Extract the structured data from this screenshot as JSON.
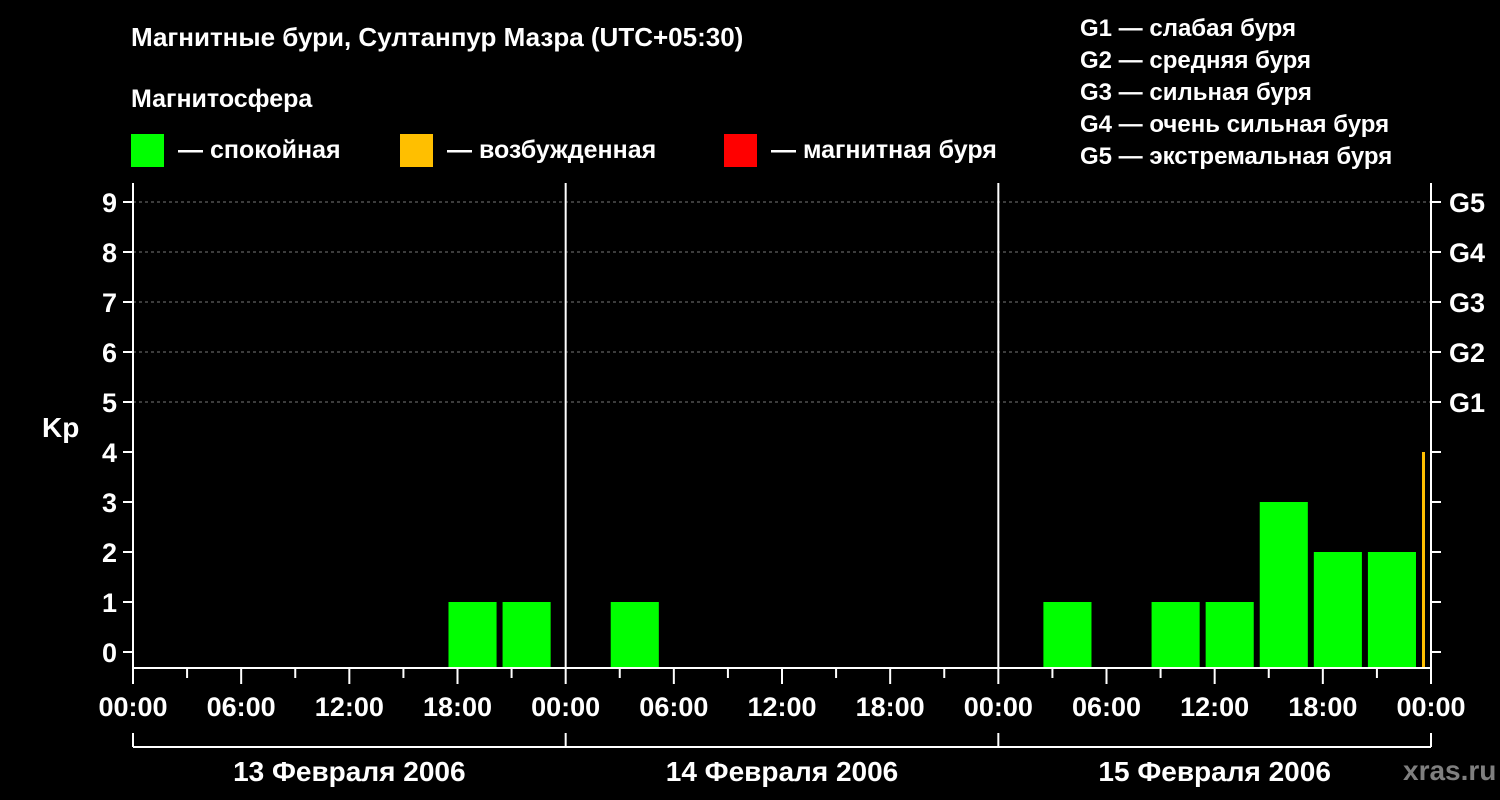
{
  "chart_data": {
    "type": "bar",
    "title": "Магнитные бури, Султанпур Мазра (UTC+05:30)",
    "subtitle": "Магнитосфера",
    "ylabel": "Kp",
    "ylim": [
      0,
      9
    ],
    "y_ticks": [
      "0",
      "1",
      "2",
      "3",
      "4",
      "5",
      "6",
      "7",
      "8",
      "9"
    ],
    "g_ticks": [
      {
        "kp": 5,
        "label": "G1"
      },
      {
        "kp": 6,
        "label": "G2"
      },
      {
        "kp": 7,
        "label": "G3"
      },
      {
        "kp": 8,
        "label": "G4"
      },
      {
        "kp": 9,
        "label": "G5"
      }
    ],
    "x_tick_labels": [
      "00:00",
      "06:00",
      "12:00",
      "18:00",
      "00:00",
      "06:00",
      "12:00",
      "18:00",
      "00:00",
      "06:00",
      "12:00",
      "18:00",
      "00:00"
    ],
    "days": [
      "13 Февраля 2006",
      "14 Февраля 2006",
      "15 Февраля 2006"
    ],
    "legend": [
      {
        "label": "— спокойная",
        "color": "#00ff00"
      },
      {
        "label": "— возбужденная",
        "color": "#ffbf00"
      },
      {
        "label": "— магнитная буря",
        "color": "#ff0000"
      }
    ],
    "g_scale": [
      "G1 — слабая буря",
      "G2 — средняя буря",
      "G3 — сильная буря",
      "G4 — очень сильная буря",
      "G5 — экстремальная буря"
    ],
    "bars": [
      {
        "day": 0,
        "start_hour": 17.5,
        "end_hour": 20.5,
        "kp": 1,
        "state": "quiet"
      },
      {
        "day": 0,
        "start_hour": 20.5,
        "end_hour": 23.5,
        "kp": 1,
        "state": "quiet"
      },
      {
        "day": 1,
        "start_hour": 2.5,
        "end_hour": 5.5,
        "kp": 1,
        "state": "quiet"
      },
      {
        "day": 2,
        "start_hour": 2.5,
        "end_hour": 5.5,
        "kp": 1,
        "state": "quiet"
      },
      {
        "day": 2,
        "start_hour": 8.5,
        "end_hour": 11.5,
        "kp": 1,
        "state": "quiet"
      },
      {
        "day": 2,
        "start_hour": 11.5,
        "end_hour": 14.5,
        "kp": 1,
        "state": "quiet"
      },
      {
        "day": 2,
        "start_hour": 14.5,
        "end_hour": 17.5,
        "kp": 3,
        "state": "quiet"
      },
      {
        "day": 2,
        "start_hour": 17.5,
        "end_hour": 20.5,
        "kp": 2,
        "state": "quiet"
      },
      {
        "day": 2,
        "start_hour": 20.5,
        "end_hour": 23.5,
        "kp": 2,
        "state": "quiet"
      },
      {
        "day": 2,
        "start_hour": 23.5,
        "end_hour": 24,
        "kp": 4,
        "state": "active"
      }
    ],
    "colors": {
      "quiet": "#00ff00",
      "active": "#ffbf00",
      "storm": "#ff0000"
    },
    "grid": true
  },
  "watermark": "xras.ru"
}
